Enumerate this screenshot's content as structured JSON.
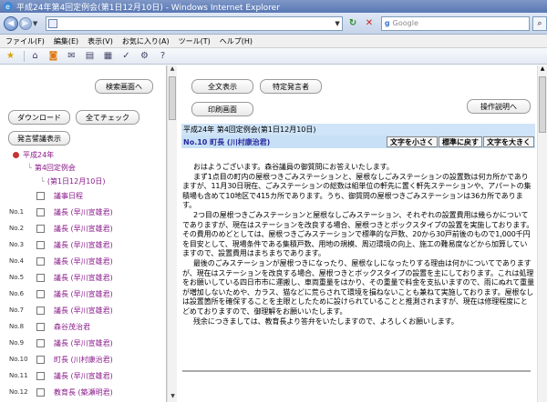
{
  "window": {
    "title": "平成24年第4回定例会(第1日12月10日) - Windows Internet Explorer"
  },
  "address": {
    "url": ""
  },
  "search": {
    "placeholder": "Google",
    "engine_badge": "g"
  },
  "menu": [
    "ファイル(F)",
    "編集(E)",
    "表示(V)",
    "お気に入り(A)",
    "ツール(T)",
    "ヘルプ(H)"
  ],
  "left": {
    "search_screen_btn": "検索画面へ",
    "download_btn": "ダウンロード",
    "check_all_btn": "全てチェック",
    "speaker_list_btn": "発言譬議表示",
    "tree_root": "平成24年",
    "tree_session": "第4回定例会",
    "tree_day": "(第1日12月10日)",
    "rows": [
      {
        "no": "",
        "text": "議事日程"
      },
      {
        "no": "No.1",
        "text": "議長 (早川宣雄君)"
      },
      {
        "no": "No.2",
        "text": "議長 (早川宣雄君)"
      },
      {
        "no": "No.3",
        "text": "議長 (早川宣雄君)"
      },
      {
        "no": "No.4",
        "text": "議長 (早川宣雄君)"
      },
      {
        "no": "No.5",
        "text": "議長 (早川宣雄君)"
      },
      {
        "no": "No.6",
        "text": "議長 (早川宣雄君)"
      },
      {
        "no": "No.7",
        "text": "議長 (早川宣雄君)"
      },
      {
        "no": "No.8",
        "text": "森谷茂治君"
      },
      {
        "no": "No.9",
        "text": "議長 (早川宣雄君)"
      },
      {
        "no": "No.10",
        "text": "町長 (川村康治君)"
      },
      {
        "no": "No.11",
        "text": "議長 (早川宣雄君)"
      },
      {
        "no": "No.12",
        "text": "教育長 (築瀬明君)"
      }
    ]
  },
  "right": {
    "show_all_btn": "全文表示",
    "specific_speaker_btn": "特定発言者",
    "print_btn": "印刷画面",
    "manual_btn": "操作説明へ",
    "meeting_title": "平成24年 第4回定例会(第1日12月10日)",
    "speaker": "No.10 町長 (川村康治君)",
    "font_small": "文字を小さく",
    "font_normal": "標準に戻す",
    "font_large": "文字を大きく",
    "paragraphs": [
      "おはようございます。森谷議員の御質問にお答えいたします。",
      "まず1点目の町内の屋根つきごみステーションと、屋根なしごみステーションの設置数は何カ所かでありますが、11月30日現在、ごみステーションの総数は組単位の軒先に置く軒先ステーションや、アパートの集積場も含めて10地区で415カ所であります。うち、御質問の屋根つきごみステーションは36カ所であります。",
      "2つ目の屋根つきごみステーションと屋根なしごみステーション、それぞれの設置費用は幾らかについてでありますが、現在はステーションを改良する場合、屋根つきとボックスタイプの設置を実施しております。その費用のめどとしては、屋根つきごみステーションで標準的な戸数、20から30戸前後のもので1,000千円を目安として、現場条件である集積戸数、用地の規模、周辺環境の向上、施工の難易度などから加算していますので、設置費用はまちまちであります。",
      "最後のごみステーションが屋根つきになったり、屋根なしになったりする理由は何かについてでありますが、現在はステーションを改良する場合、屋根つきとボックスタイプの設置を主にしております。これは処理をお願いしている四日市市に運搬し、車両重量をはかり、その重量で料金を支払いますので、雨にぬれて重量が増加しないためや、カラス、猫などに荒らされて環境を損ねないことも兼ねて実施しております。屋根なしは設置箇所を確保することを主眼としたために設けられていることと推測されますが、現在は修理程度にとどめておりますので、御理解をお願いいたします。",
      "残余につきましては、教育長より答弁をいたしますので、よろしくお願いします。"
    ]
  }
}
